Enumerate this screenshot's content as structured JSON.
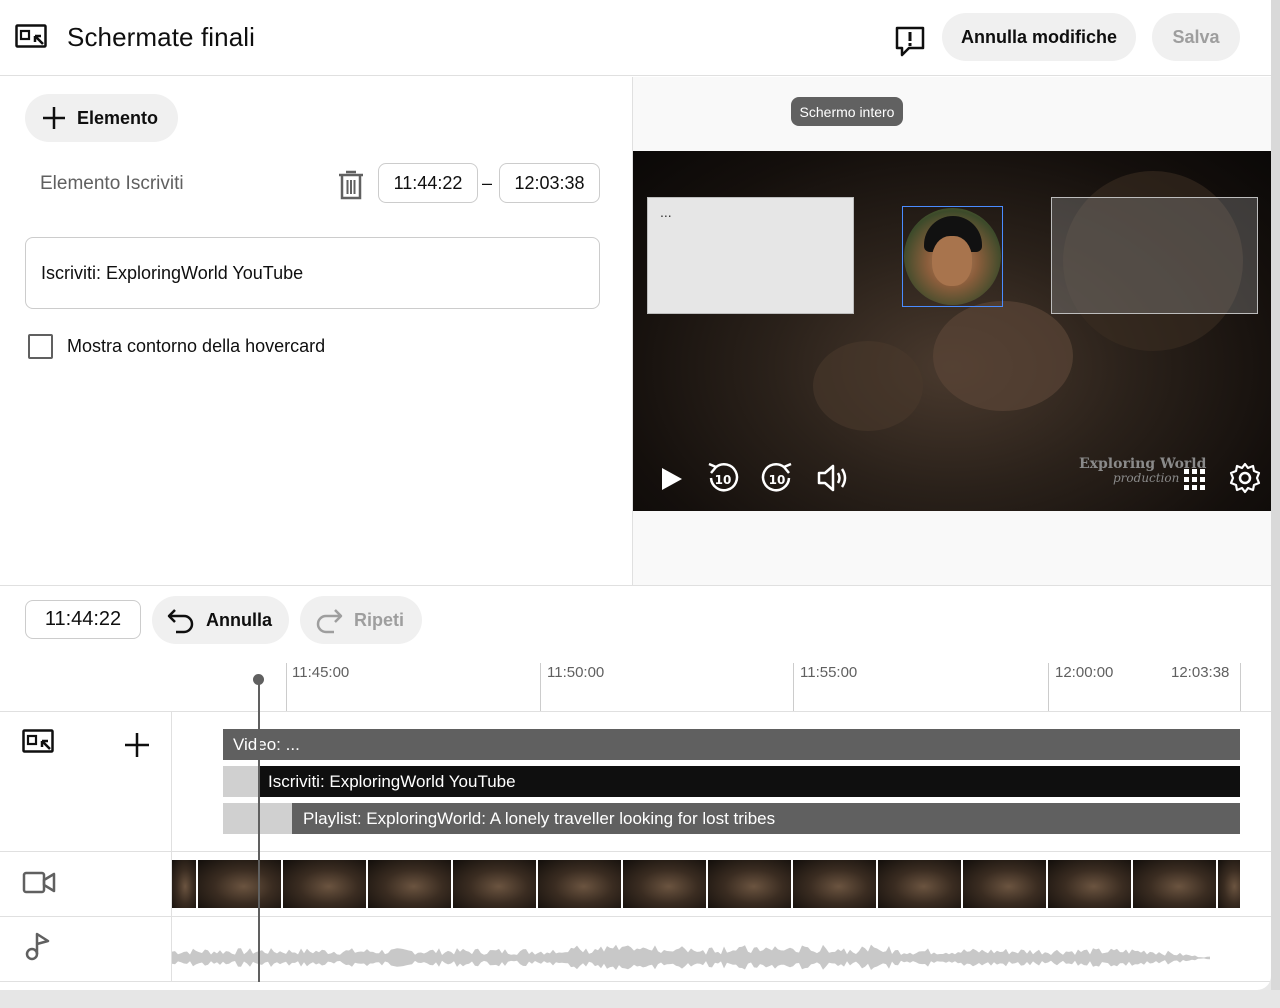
{
  "header": {
    "title": "Schermate finali",
    "discard_label": "Annulla modifiche",
    "save_label": "Salva"
  },
  "editor": {
    "add_element_label": "Elemento",
    "element_name": "Elemento Iscriviti",
    "start_time": "11:44:22",
    "time_separator": "–",
    "end_time": "12:03:38",
    "element_value": "Iscriviti: ExploringWorld YouTube",
    "checkbox_label": "Mostra contorno della hovercard",
    "checkbox_checked": false
  },
  "preview": {
    "tooltip": "Schermo intero",
    "video_card_text": "...",
    "watermark_line1": "Exploring World",
    "watermark_line2": "production",
    "icons": [
      "play-icon",
      "rewind-10-icon",
      "forward-10-icon",
      "volume-icon",
      "grid-icon",
      "settings-icon"
    ]
  },
  "toolbar": {
    "current_time": "11:44:22",
    "undo_label": "Annulla",
    "redo_label": "Ripeti"
  },
  "timeline": {
    "ticks": [
      "11:45:00",
      "11:50:00",
      "11:55:00",
      "12:00:00",
      "12:03:38"
    ],
    "elements": [
      {
        "label": "Video: ..."
      },
      {
        "label": "Iscriviti: ExploringWorld YouTube"
      },
      {
        "label": "Playlist: ExploringWorld: A lonely traveller looking for lost tribes"
      }
    ],
    "track_icons": [
      "endscreen-icon",
      "add-icon",
      "video-camera-icon",
      "music-note-icon"
    ]
  },
  "colors": {
    "accent_blue": "#4a8cff",
    "bar_dark": "#0f0f0f",
    "bar_gray": "#606060",
    "button_bg": "#f0f0f0"
  }
}
